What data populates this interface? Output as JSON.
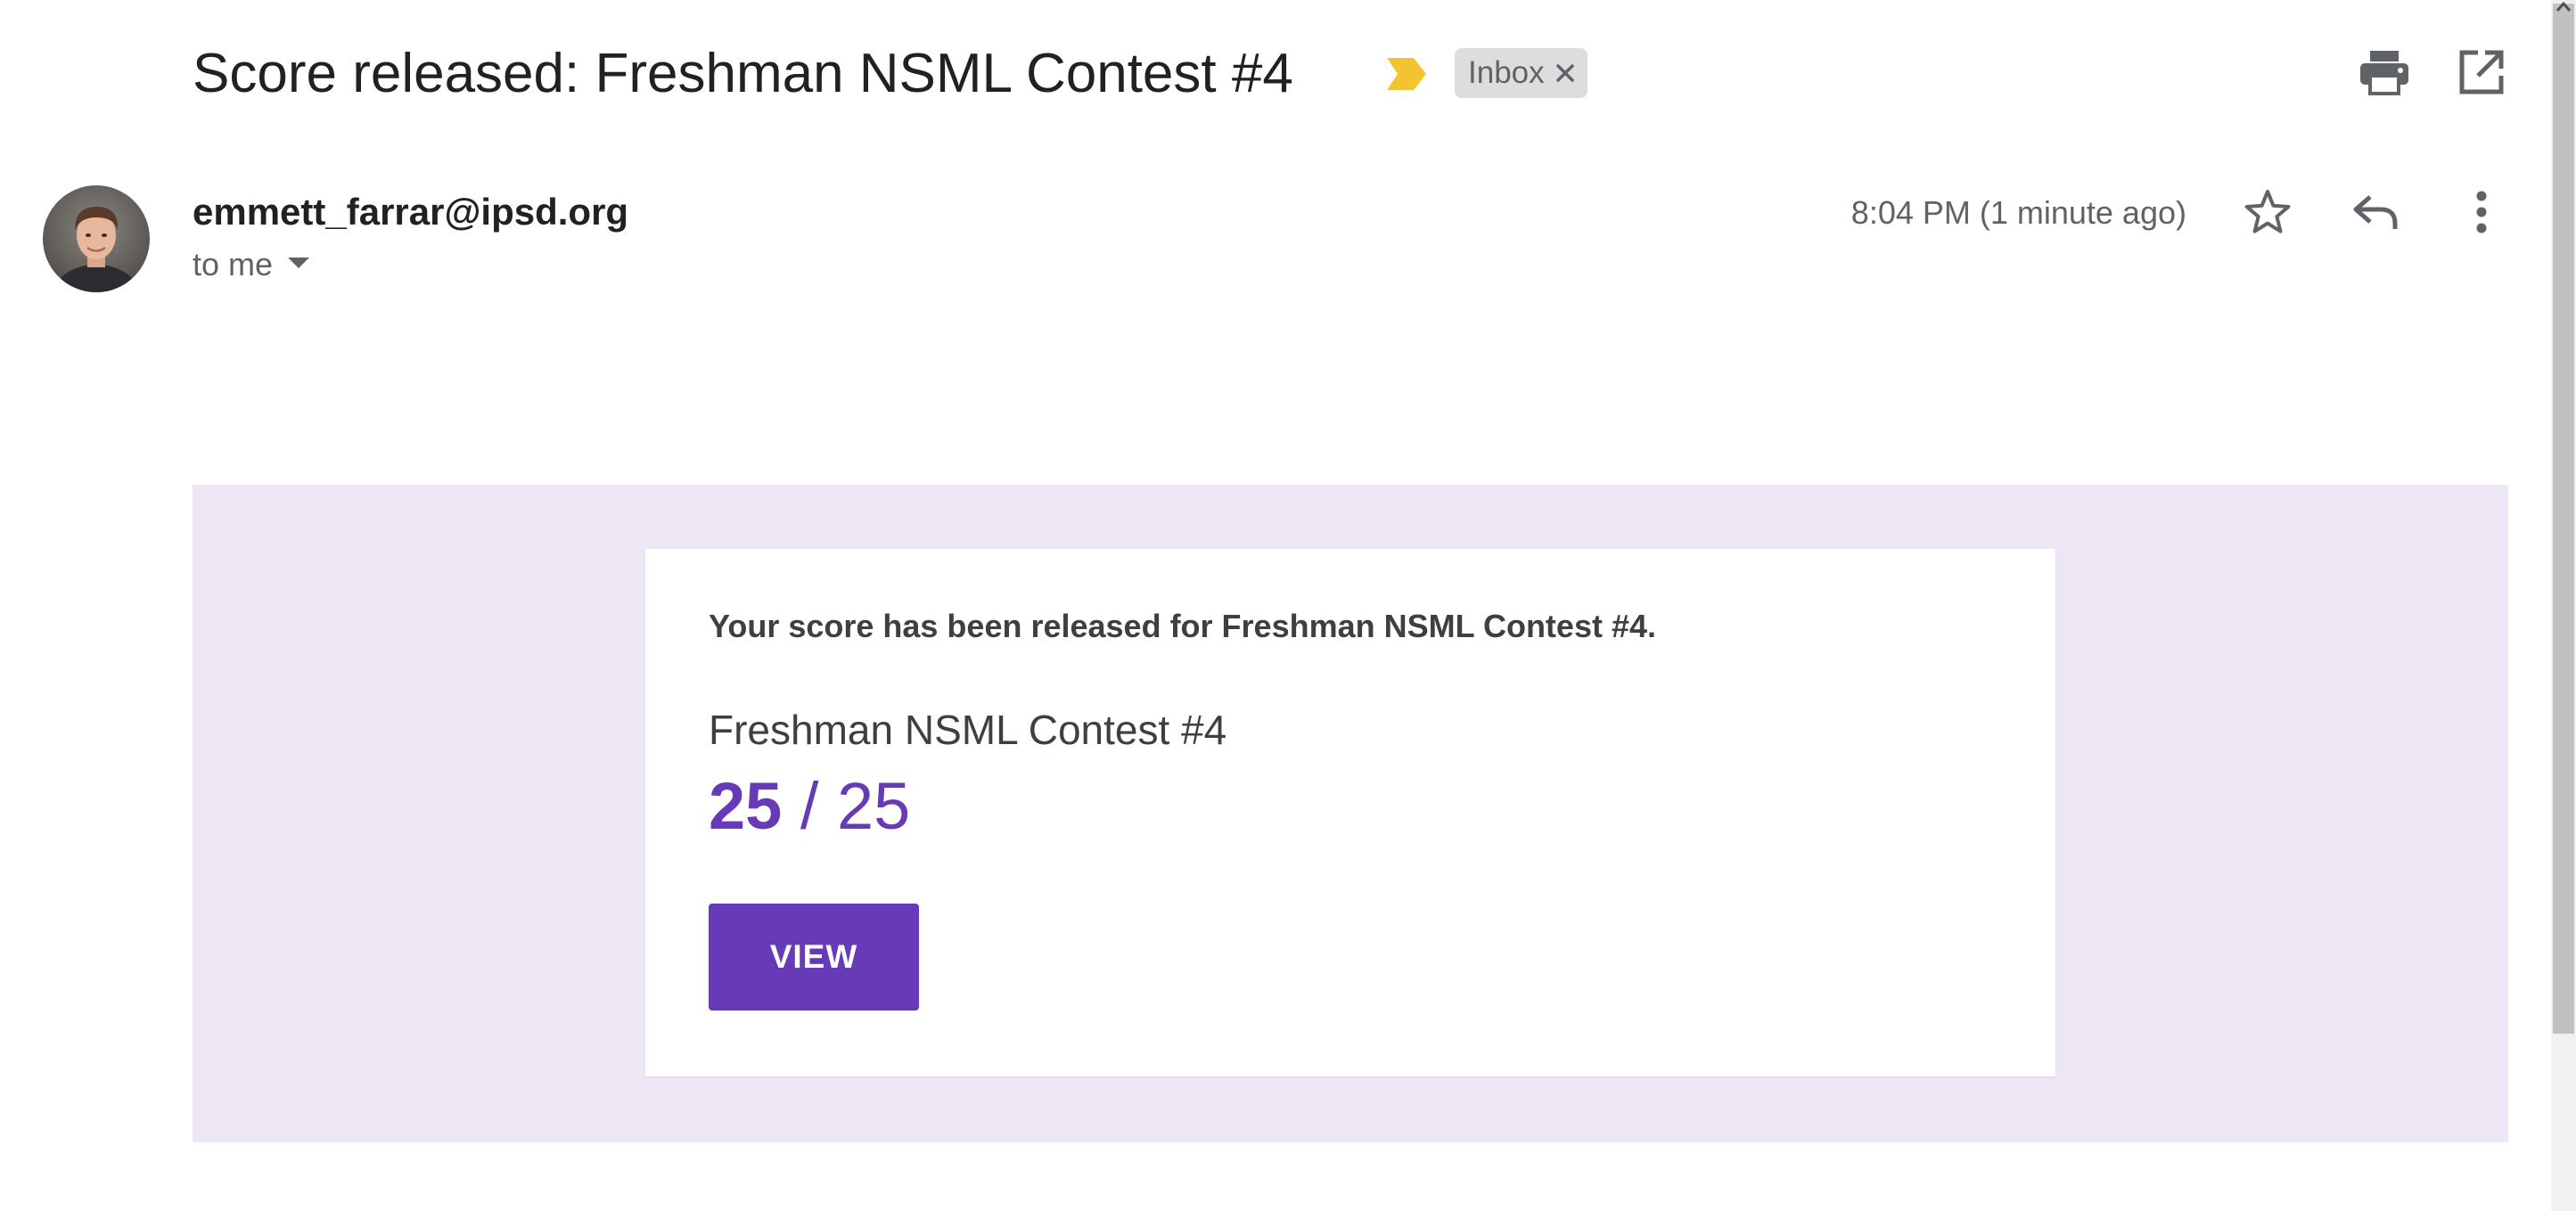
{
  "message": {
    "subject": "Score released: Freshman NSML Contest #4",
    "label": "Inbox",
    "sender": "emmett_farrar@ipsd.org",
    "recipient_line": "to me",
    "timestamp": "8:04 PM (1 minute ago)"
  },
  "icons": {
    "important_marker": "important-marker-icon",
    "label_remove": "close-icon",
    "print": "print-icon",
    "open_new_window": "open-in-new-window-icon",
    "recipient_details": "chevron-down-icon",
    "star": "star-icon",
    "reply": "reply-icon",
    "more": "more-vertical-icon"
  },
  "email_body": {
    "notice": "Your score has been released for Freshman NSML Contest #4.",
    "quiz_title": "Freshman NSML Contest #4",
    "score_earned": "25",
    "score_separator": "/",
    "score_total": "25",
    "button_label": "VIEW"
  },
  "colors": {
    "accent": "#673ab7",
    "banner_background": "#ede6f4",
    "important_marker": "#f4c430",
    "label_chip": "#dddddd"
  }
}
